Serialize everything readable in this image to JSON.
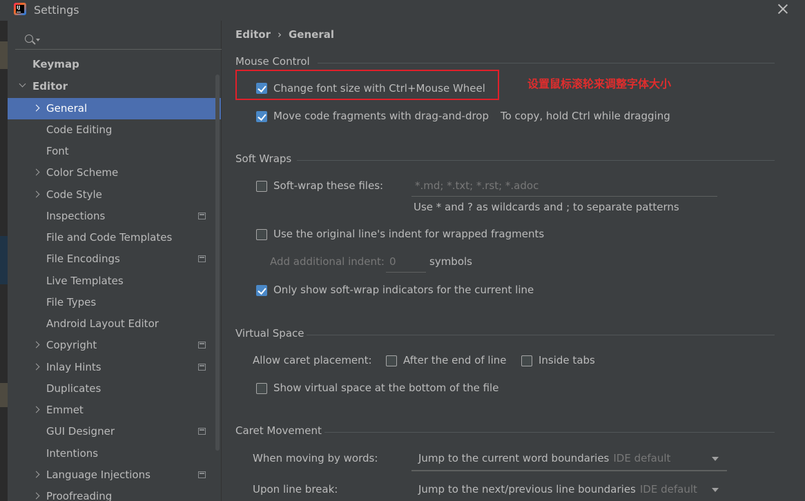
{
  "window": {
    "title": "Settings"
  },
  "sidebar": {
    "search": {
      "placeholder": ""
    },
    "items": [
      {
        "label": "Keymap"
      },
      {
        "label": "Editor"
      },
      {
        "label": "General"
      },
      {
        "label": "Code Editing"
      },
      {
        "label": "Font"
      },
      {
        "label": "Color Scheme"
      },
      {
        "label": "Code Style"
      },
      {
        "label": "Inspections"
      },
      {
        "label": "File and Code Templates"
      },
      {
        "label": "File Encodings"
      },
      {
        "label": "Live Templates"
      },
      {
        "label": "File Types"
      },
      {
        "label": "Android Layout Editor"
      },
      {
        "label": "Copyright"
      },
      {
        "label": "Inlay Hints"
      },
      {
        "label": "Duplicates"
      },
      {
        "label": "Emmet"
      },
      {
        "label": "GUI Designer"
      },
      {
        "label": "Intentions"
      },
      {
        "label": "Language Injections"
      },
      {
        "label": "Proofreading"
      }
    ]
  },
  "breadcrumb": {
    "parent": "Editor",
    "separator": "›",
    "current": "General"
  },
  "mouse_control": {
    "title": "Mouse Control",
    "change_font_size": {
      "label": "Change font size with Ctrl+Mouse Wheel",
      "checked": true
    },
    "move_fragments": {
      "label": "Move code fragments with drag-and-drop",
      "checked": true
    },
    "move_hint": "To copy, hold Ctrl while dragging",
    "annotation": "设置鼠标滚轮来调整字体大小"
  },
  "soft_wraps": {
    "title": "Soft Wraps",
    "soft_wrap_files": {
      "label": "Soft-wrap these files:",
      "checked": false,
      "placeholder": "*.md; *.txt; *.rst; *.adoc"
    },
    "wildcard_hint": "Use * and ? as wildcards and ; to separate patterns",
    "original_indent": {
      "label": "Use the original line's indent for wrapped fragments",
      "checked": false
    },
    "additional_indent": {
      "label": "Add additional indent:",
      "value": "0",
      "unit": "symbols"
    },
    "only_current_line": {
      "label": "Only show soft-wrap indicators for the current line",
      "checked": true
    }
  },
  "virtual_space": {
    "title": "Virtual Space",
    "allow_caret_label": "Allow caret placement:",
    "after_end": {
      "label": "After the end of line",
      "checked": false
    },
    "inside_tabs": {
      "label": "Inside tabs",
      "checked": false
    },
    "show_bottom": {
      "label": "Show virtual space at the bottom of the file",
      "checked": false
    }
  },
  "caret_movement": {
    "title": "Caret Movement",
    "moving_by_words": {
      "label": "When moving by words:",
      "value": "Jump to the current word boundaries",
      "hint": "IDE default"
    },
    "line_break": {
      "label": "Upon line break:",
      "value": "Jump to the next/previous line boundaries",
      "hint": "IDE default"
    }
  },
  "colors": {
    "accent": "#4b6eaf",
    "checkbox": "#4a88c7",
    "annotation": "#e02d2d"
  }
}
